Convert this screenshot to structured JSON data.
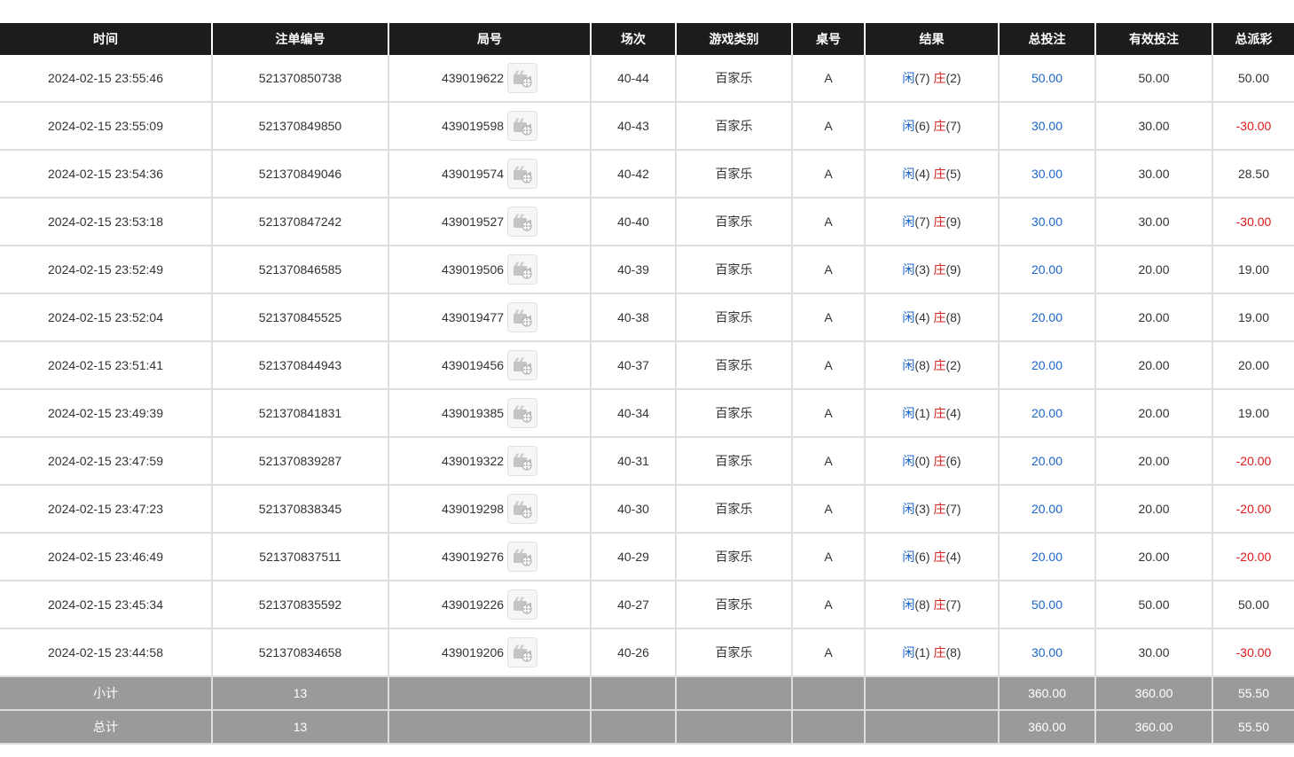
{
  "table": {
    "columns": [
      "时间",
      "注单编号",
      "局号",
      "场次",
      "游戏类别",
      "桌号",
      "结果",
      "总投注",
      "有效投注",
      "总派彩"
    ],
    "result_labels": {
      "player": "闲",
      "banker": "庄"
    },
    "rows": [
      {
        "time": "2024-02-15 23:55:46",
        "bet_id": "521370850738",
        "round_id": "439019622",
        "session": "40-44",
        "game": "百家乐",
        "table_no": "A",
        "player": "(7)",
        "banker": "(2)",
        "total_bet": "50.00",
        "valid_bet": "50.00",
        "payout": "50.00",
        "negative": false
      },
      {
        "time": "2024-02-15 23:55:09",
        "bet_id": "521370849850",
        "round_id": "439019598",
        "session": "40-43",
        "game": "百家乐",
        "table_no": "A",
        "player": "(6)",
        "banker": "(7)",
        "total_bet": "30.00",
        "valid_bet": "30.00",
        "payout": "-30.00",
        "negative": true
      },
      {
        "time": "2024-02-15 23:54:36",
        "bet_id": "521370849046",
        "round_id": "439019574",
        "session": "40-42",
        "game": "百家乐",
        "table_no": "A",
        "player": "(4)",
        "banker": "(5)",
        "total_bet": "30.00",
        "valid_bet": "30.00",
        "payout": "28.50",
        "negative": false
      },
      {
        "time": "2024-02-15 23:53:18",
        "bet_id": "521370847242",
        "round_id": "439019527",
        "session": "40-40",
        "game": "百家乐",
        "table_no": "A",
        "player": "(7)",
        "banker": "(9)",
        "total_bet": "30.00",
        "valid_bet": "30.00",
        "payout": "-30.00",
        "negative": true
      },
      {
        "time": "2024-02-15 23:52:49",
        "bet_id": "521370846585",
        "round_id": "439019506",
        "session": "40-39",
        "game": "百家乐",
        "table_no": "A",
        "player": "(3)",
        "banker": "(9)",
        "total_bet": "20.00",
        "valid_bet": "20.00",
        "payout": "19.00",
        "negative": false
      },
      {
        "time": "2024-02-15 23:52:04",
        "bet_id": "521370845525",
        "round_id": "439019477",
        "session": "40-38",
        "game": "百家乐",
        "table_no": "A",
        "player": "(4)",
        "banker": "(8)",
        "total_bet": "20.00",
        "valid_bet": "20.00",
        "payout": "19.00",
        "negative": false
      },
      {
        "time": "2024-02-15 23:51:41",
        "bet_id": "521370844943",
        "round_id": "439019456",
        "session": "40-37",
        "game": "百家乐",
        "table_no": "A",
        "player": "(8)",
        "banker": "(2)",
        "total_bet": "20.00",
        "valid_bet": "20.00",
        "payout": "20.00",
        "negative": false
      },
      {
        "time": "2024-02-15 23:49:39",
        "bet_id": "521370841831",
        "round_id": "439019385",
        "session": "40-34",
        "game": "百家乐",
        "table_no": "A",
        "player": "(1)",
        "banker": "(4)",
        "total_bet": "20.00",
        "valid_bet": "20.00",
        "payout": "19.00",
        "negative": false
      },
      {
        "time": "2024-02-15 23:47:59",
        "bet_id": "521370839287",
        "round_id": "439019322",
        "session": "40-31",
        "game": "百家乐",
        "table_no": "A",
        "player": "(0)",
        "banker": "(6)",
        "total_bet": "20.00",
        "valid_bet": "20.00",
        "payout": "-20.00",
        "negative": true
      },
      {
        "time": "2024-02-15 23:47:23",
        "bet_id": "521370838345",
        "round_id": "439019298",
        "session": "40-30",
        "game": "百家乐",
        "table_no": "A",
        "player": "(3)",
        "banker": "(7)",
        "total_bet": "20.00",
        "valid_bet": "20.00",
        "payout": "-20.00",
        "negative": true
      },
      {
        "time": "2024-02-15 23:46:49",
        "bet_id": "521370837511",
        "round_id": "439019276",
        "session": "40-29",
        "game": "百家乐",
        "table_no": "A",
        "player": "(6)",
        "banker": "(4)",
        "total_bet": "20.00",
        "valid_bet": "20.00",
        "payout": "-20.00",
        "negative": true
      },
      {
        "time": "2024-02-15 23:45:34",
        "bet_id": "521370835592",
        "round_id": "439019226",
        "session": "40-27",
        "game": "百家乐",
        "table_no": "A",
        "player": "(8)",
        "banker": "(7)",
        "total_bet": "50.00",
        "valid_bet": "50.00",
        "payout": "50.00",
        "negative": false
      },
      {
        "time": "2024-02-15 23:44:58",
        "bet_id": "521370834658",
        "round_id": "439019206",
        "session": "40-26",
        "game": "百家乐",
        "table_no": "A",
        "player": "(1)",
        "banker": "(8)",
        "total_bet": "30.00",
        "valid_bet": "30.00",
        "payout": "-30.00",
        "negative": true
      }
    ],
    "subtotal": {
      "label": "小计",
      "count": "13",
      "total_bet": "360.00",
      "valid_bet": "360.00",
      "payout": "55.50"
    },
    "total": {
      "label": "总计",
      "count": "13",
      "total_bet": "360.00",
      "valid_bet": "360.00",
      "payout": "55.50"
    }
  },
  "icons": {
    "replay": "video-replay-icon"
  },
  "colors": {
    "header_bg": "#1c1c1c",
    "footer_bg": "#9a9a9a",
    "link_blue": "#1a66cc",
    "negative_red": "#e01818",
    "banker_red": "#d32020"
  }
}
